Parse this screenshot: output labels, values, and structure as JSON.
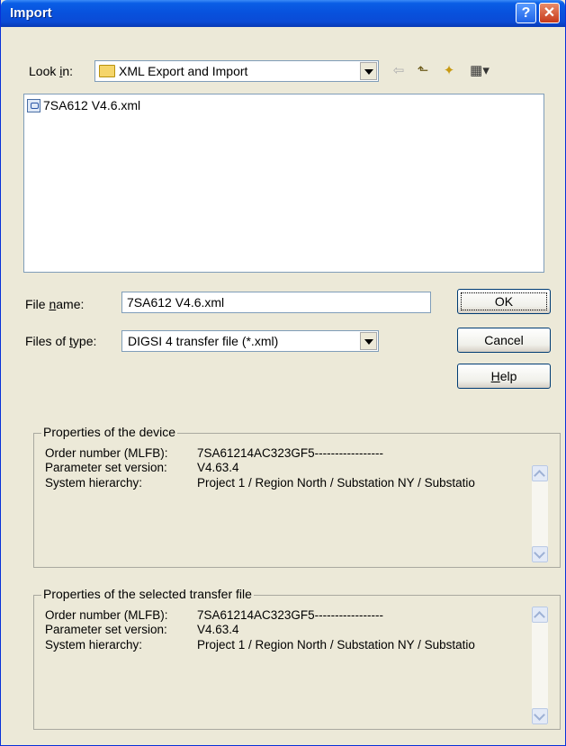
{
  "window": {
    "title": "Import",
    "help_glyph": "?",
    "close_glyph": "✕"
  },
  "lookin": {
    "label_pre": "Look ",
    "label_u": "i",
    "label_post": "n:",
    "value": "XML Export and Import"
  },
  "toolbar": {
    "back": "⇦",
    "up": "⬑",
    "newfolder": "✦",
    "views": "▦▾"
  },
  "files": [
    {
      "name": "7SA612 V4.6.xml"
    }
  ],
  "filename": {
    "label_pre": "File ",
    "label_u": "n",
    "label_post": "ame:",
    "value": "7SA612 V4.6.xml"
  },
  "filetype": {
    "label_pre": "Files of ",
    "label_u": "t",
    "label_post": "ype:",
    "value": "DIGSI 4 transfer file (*.xml)"
  },
  "buttons": {
    "ok": "OK",
    "cancel": "Cancel",
    "help_u": "H",
    "help_rest": "elp"
  },
  "device": {
    "legend": "Properties of the device",
    "order_label": "Order number (MLFB):",
    "order_value": "7SA61214AC323GF5-----------------",
    "param_label": "Parameter set version:",
    "param_value": "V4.63.4",
    "hier_label": "System hierarchy:",
    "hier_value": "Project 1 / Region North / Substation NY / Substatio"
  },
  "transfer": {
    "legend": "Properties of the selected transfer file",
    "order_label": "Order number (MLFB):",
    "order_value": "7SA61214AC323GF5-----------------",
    "param_label": "Parameter set version:",
    "param_value": "V4.63.4",
    "hier_label": "System hierarchy:",
    "hier_value": "Project 1 / Region North / Substation NY / Substatio"
  }
}
